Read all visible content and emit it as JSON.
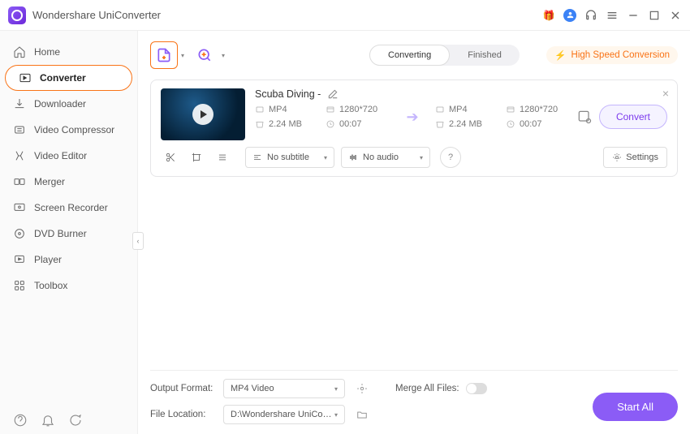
{
  "app": {
    "title": "Wondershare UniConverter"
  },
  "sidebar": {
    "items": [
      {
        "label": "Home"
      },
      {
        "label": "Converter"
      },
      {
        "label": "Downloader"
      },
      {
        "label": "Video Compressor"
      },
      {
        "label": "Video Editor"
      },
      {
        "label": "Merger"
      },
      {
        "label": "Screen Recorder"
      },
      {
        "label": "DVD Burner"
      },
      {
        "label": "Player"
      },
      {
        "label": "Toolbox"
      }
    ]
  },
  "tabs": {
    "converting": "Converting",
    "finished": "Finished"
  },
  "toolbar": {
    "highspeed": "High Speed Conversion"
  },
  "file": {
    "name": "Scuba Diving -",
    "src": {
      "format": "MP4",
      "resolution": "1280*720",
      "size": "2.24 MB",
      "duration": "00:07"
    },
    "dst": {
      "format": "MP4",
      "resolution": "1280*720",
      "size": "2.24 MB",
      "duration": "00:07"
    },
    "subtitle": "No subtitle",
    "audio": "No audio",
    "convert_label": "Convert",
    "settings_label": "Settings"
  },
  "bottom": {
    "output_format_label": "Output Format:",
    "output_format_value": "MP4 Video",
    "file_location_label": "File Location:",
    "file_location_value": "D:\\Wondershare UniConverter",
    "merge_label": "Merge All Files:",
    "start_all": "Start All"
  }
}
